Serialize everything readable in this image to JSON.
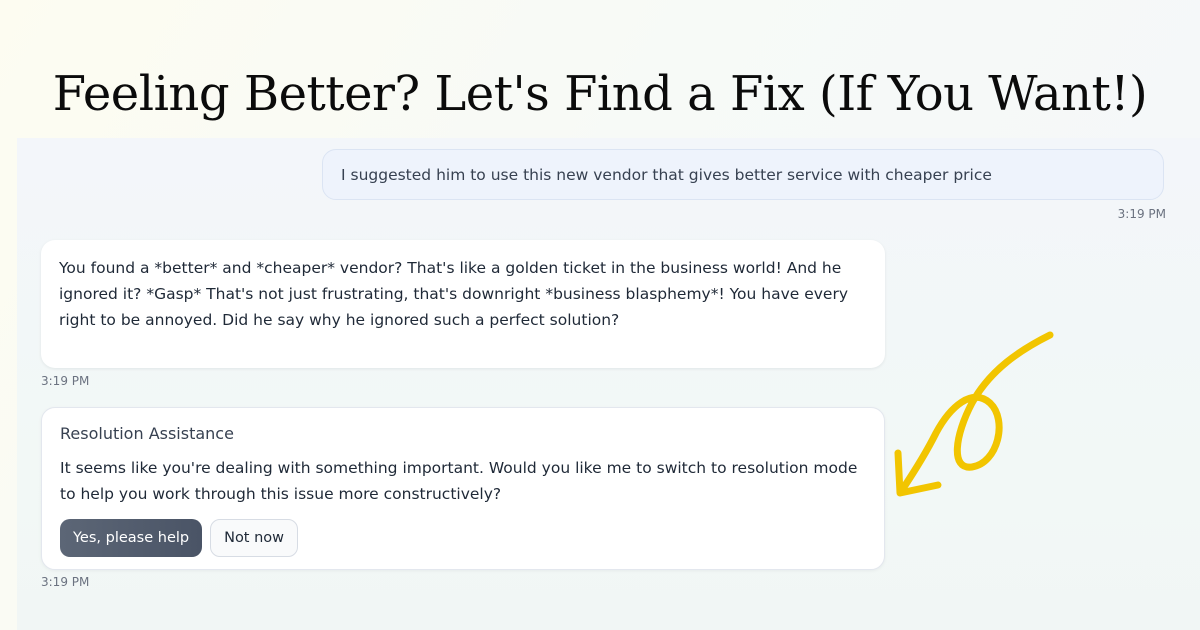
{
  "headline": "Feeling Better? Let's Find a Fix (If You Want!)",
  "messages": {
    "user": {
      "text": "I suggested him to use this new vendor that gives better service with cheaper price",
      "time": "3:19 PM"
    },
    "assistant": {
      "text": "You found a *better* and *cheaper* vendor? That's like a golden ticket in the business world! And he ignored it? *Gasp* That's not just frustrating, that's downright *business blasphemy*! You have every right to be annoyed. Did he say why he ignored such a perfect solution?",
      "time": "3:19 PM"
    },
    "resolution": {
      "title": "Resolution Assistance",
      "text": "It seems like you're dealing with something important. Would you like me to switch to resolution mode to help you work through this issue more constructively?",
      "primary_button": "Yes, please help",
      "secondary_button": "Not now",
      "time": "3:19 PM"
    }
  },
  "colors": {
    "arrow": "#f2c500",
    "user_bubble": "#eef3fc",
    "primary_button": "#525c6e"
  },
  "icons": {
    "annotation": "curved-arrow-icon"
  }
}
